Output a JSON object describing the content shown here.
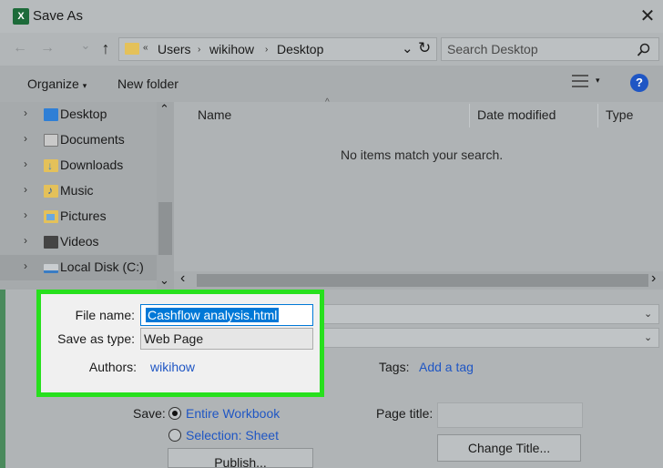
{
  "window": {
    "title": "Save As",
    "app_icon": "excel-icon",
    "close_glyph": "✕"
  },
  "nav": {
    "back": "←",
    "forward": "→",
    "recent": "⌄",
    "up": "↑",
    "breadcrumb": [
      "Users",
      "wikihow",
      "Desktop"
    ],
    "breadcrumb_sep": "›",
    "overflow": "«",
    "dropdown": "⌄",
    "refresh": "↻"
  },
  "search": {
    "placeholder": "Search Desktop",
    "icon": "search-icon"
  },
  "toolbar": {
    "organize": "Organize",
    "new_folder": "New folder",
    "help": "?",
    "caret": "▾"
  },
  "sidebar": {
    "items": [
      {
        "label": "Desktop",
        "color": "#2f7fd6",
        "selected": false
      },
      {
        "label": "Documents",
        "color": "#c9c9c9",
        "selected": false
      },
      {
        "label": "Downloads",
        "color": "#2f7fd6",
        "selected": false
      },
      {
        "label": "Music",
        "color": "#e4c15a",
        "selected": false
      },
      {
        "label": "Pictures",
        "color": "#e4c15a",
        "selected": false
      },
      {
        "label": "Videos",
        "color": "#444444",
        "selected": false
      },
      {
        "label": "Local Disk (C:)",
        "color": "#3a7cc4",
        "selected": true
      }
    ],
    "chevron": "›",
    "scroll_up": "⌃",
    "scroll_down": "⌄"
  },
  "columns": {
    "name": "Name",
    "date_modified": "Date modified",
    "type": "Type",
    "sort_arrow": "^"
  },
  "empty_message": "No items match your search.",
  "hscroll": {
    "left": "‹",
    "right": "›"
  },
  "form": {
    "file_name_label": "File name:",
    "file_name_value": "Cashflow analysis.html",
    "save_as_type_label": "Save as type:",
    "save_as_type_value": "Web Page",
    "authors_label": "Authors:",
    "authors_value": "wikihow",
    "tags_label": "Tags:",
    "tags_value": "Add a tag",
    "save_label": "Save:",
    "option_entire": "Entire Workbook",
    "option_selection": "Selection: Sheet",
    "page_title_label": "Page title:",
    "change_title_button": "Change Title...",
    "publish_button": "Publish...",
    "combo_arrow": "⌄"
  },
  "colors": {
    "highlight_border": "#27e01d",
    "selection_blue": "#0078d7",
    "link_blue": "#1f56c4"
  }
}
